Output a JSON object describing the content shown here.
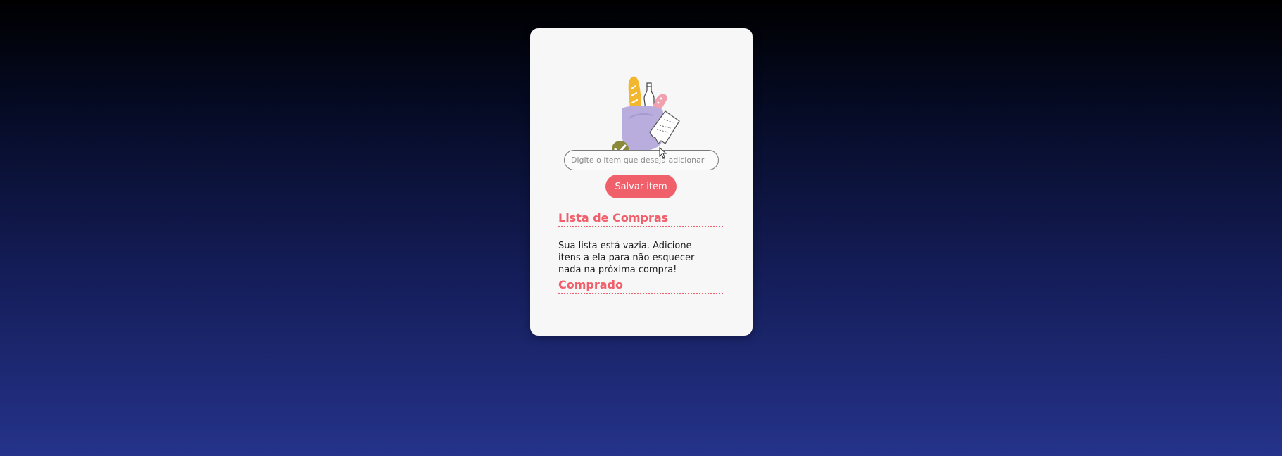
{
  "form": {
    "input_placeholder": "Digite o item que deseja adicionar",
    "save_label": "Salvar item"
  },
  "shopping_list": {
    "title": "Lista de Compras",
    "empty_message": "Sua lista está vazia. Adicione itens a ela para não esquecer nada na próxima compra!"
  },
  "bought": {
    "title": "Comprado"
  },
  "colors": {
    "accent": "#f0606b",
    "card_background": "#f7f7f7",
    "page_gradient_top": "#000000",
    "page_gradient_bottom": "#25338a"
  },
  "illustration": {
    "icon": "shopping-bag-icon",
    "check_icon": "check-circle-icon"
  }
}
